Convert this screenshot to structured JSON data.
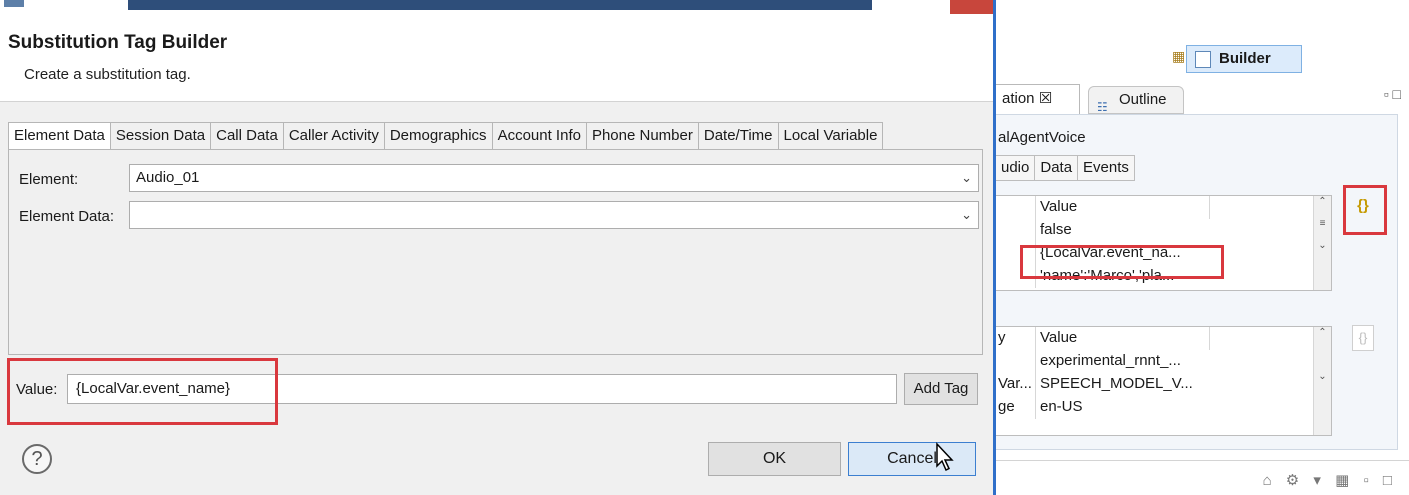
{
  "dialog": {
    "title": "Substitution Tag Builder",
    "subtitle": "Create a substitution tag.",
    "tabs": [
      {
        "label": "Element Data",
        "active": true
      },
      {
        "label": "Session Data"
      },
      {
        "label": "Call Data"
      },
      {
        "label": "Caller Activity"
      },
      {
        "label": "Demographics"
      },
      {
        "label": "Account Info"
      },
      {
        "label": "Phone Number"
      },
      {
        "label": "Date/Time"
      },
      {
        "label": "Local Variable"
      }
    ],
    "element_label": "Element:",
    "element_value": "Audio_01",
    "element_data_label": "Element Data:",
    "element_data_value": "",
    "value_label": "Value:",
    "value_text": "{LocalVar.event_name}",
    "add_tag_label": "Add Tag",
    "help_glyph": "?",
    "ok_label": "OK",
    "cancel_label": "Cancel"
  },
  "ide": {
    "builder_label": "Builder",
    "view_tab_partial": "ation ☒",
    "outline_label": "Outline",
    "resource_name": "alAgentVoice",
    "mini_tabs": [
      "udio",
      "Data",
      "Events"
    ],
    "table1": {
      "header_value": "Value",
      "rows": [
        "false",
        "{LocalVar.event_na...",
        "'name':'Marco','pla..."
      ]
    },
    "table2": {
      "rows": [
        {
          "key": "y",
          "value": "Value"
        },
        {
          "key": "",
          "value": "experimental_rnnt_..."
        },
        {
          "key": "Var...",
          "value": "SPEECH_MODEL_V..."
        },
        {
          "key": "ge",
          "value": "en-US"
        }
      ]
    },
    "tag_glyph": "{}"
  },
  "colors": {
    "highlight": "#d9383e",
    "accent": "#2f6fc9",
    "tag_gold": "#c59a00"
  }
}
